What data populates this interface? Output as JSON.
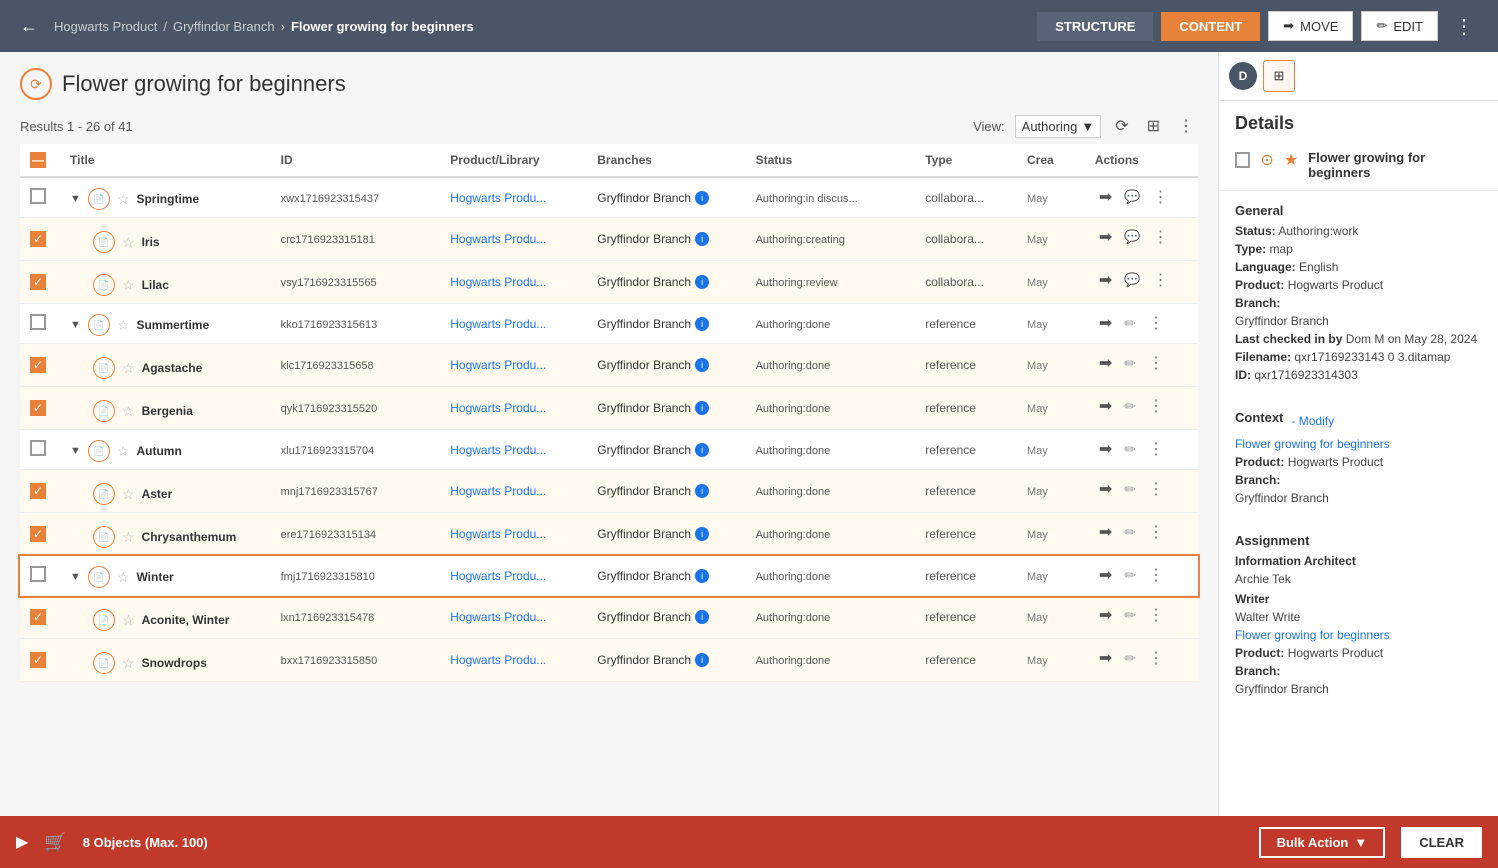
{
  "topbar": {
    "back_label": "←",
    "breadcrumb": {
      "root": "Hogwarts Product",
      "sep1": "/",
      "branch": "Gryffindor Branch",
      "sep2": "›",
      "current": "Flower growing for beginners"
    },
    "structure_label": "STRUCTURE",
    "content_label": "CONTENT",
    "move_label": "MOVE",
    "edit_label": "EDIT",
    "more_icon": "⋮"
  },
  "page": {
    "title": "Flower growing for beginners",
    "results_info": "Results 1 - 26 of 41",
    "view_label": "View:",
    "view_value": "Authoring"
  },
  "table": {
    "columns": [
      "",
      "Title",
      "ID",
      "Product/Library",
      "Branches",
      "Status",
      "Type",
      "Crea",
      "Actions"
    ],
    "rows": [
      {
        "indent": false,
        "expandable": true,
        "checked": false,
        "starred": false,
        "title": "Springtime",
        "id": "xwx1716923315437",
        "product": "Hogwarts Produ...",
        "branch": "Gryffindor Branch",
        "status": "Authoring:in discus...",
        "type": "collabora...",
        "date": "May",
        "has_move": true,
        "has_comment": true,
        "has_more": true
      },
      {
        "indent": true,
        "expandable": false,
        "checked": true,
        "starred": false,
        "title": "Iris",
        "id": "crc1716923315181",
        "product": "Hogwarts Produ...",
        "branch": "Gryffindor Branch",
        "status": "Authoring:creating",
        "type": "collabora...",
        "date": "May",
        "has_move": true,
        "has_comment": true,
        "has_more": true
      },
      {
        "indent": true,
        "expandable": false,
        "checked": true,
        "starred": false,
        "title": "Lilac",
        "id": "vsy1716923315565",
        "product": "Hogwarts Produ...",
        "branch": "Gryffindor Branch",
        "status": "Authoring:review",
        "type": "collabora...",
        "date": "May",
        "has_move": true,
        "has_comment": true,
        "has_more": true
      },
      {
        "indent": false,
        "expandable": true,
        "checked": false,
        "starred": false,
        "title": "Summertime",
        "id": "kko1716923315613",
        "product": "Hogwarts Produ...",
        "branch": "Gryffindor Branch",
        "status": "Authoring:done",
        "type": "reference",
        "date": "May",
        "has_move": true,
        "has_edit": true,
        "has_more": true
      },
      {
        "indent": true,
        "expandable": false,
        "checked": true,
        "starred": false,
        "title": "Agastache",
        "id": "kic1716923315658",
        "product": "Hogwarts Produ...",
        "branch": "Gryffindor Branch",
        "status": "Authoring:done",
        "type": "reference",
        "date": "May",
        "has_move": true,
        "has_edit": true,
        "has_more": true
      },
      {
        "indent": true,
        "expandable": false,
        "checked": true,
        "starred": false,
        "title": "Bergenia",
        "id": "qyk1716923315520",
        "product": "Hogwarts Produ...",
        "branch": "Gryffindor Branch",
        "status": "Authoring:done",
        "type": "reference",
        "date": "May",
        "has_move": true,
        "has_edit": true,
        "has_more": true
      },
      {
        "indent": false,
        "expandable": true,
        "checked": false,
        "starred": false,
        "title": "Autumn",
        "id": "xlu1716923315704",
        "product": "Hogwarts Produ...",
        "branch": "Gryffindor Branch",
        "status": "Authoring:done",
        "type": "reference",
        "date": "May",
        "has_move": true,
        "has_edit": true,
        "has_more": true
      },
      {
        "indent": true,
        "expandable": false,
        "checked": true,
        "starred": false,
        "title": "Aster",
        "id": "mnj1716923315767",
        "product": "Hogwarts Produ...",
        "branch": "Gryffindor Branch",
        "status": "Authoring:done",
        "type": "reference",
        "date": "May",
        "has_move": true,
        "has_edit": true,
        "has_more": true
      },
      {
        "indent": true,
        "expandable": false,
        "checked": true,
        "starred": false,
        "title": "Chrysanthemum",
        "id": "ere1716923315134",
        "product": "Hogwarts Produ...",
        "branch": "Gryffindor Branch",
        "status": "Authoring:done",
        "type": "reference",
        "date": "May",
        "has_move": true,
        "has_edit": true,
        "has_more": true
      },
      {
        "indent": false,
        "expandable": true,
        "checked": false,
        "starred": false,
        "title": "Winter",
        "id": "fmj1716923315810",
        "product": "Hogwarts Produ...",
        "branch": "Gryffindor Branch",
        "status": "Authoring:done",
        "type": "reference",
        "date": "May",
        "has_move": true,
        "has_edit": true,
        "has_more": true,
        "highlighted": true
      },
      {
        "indent": true,
        "expandable": false,
        "checked": true,
        "starred": false,
        "title": "Aconite, Winter",
        "id": "lxn1716923315478",
        "product": "Hogwarts Produ...",
        "branch": "Gryffindor Branch",
        "status": "Authoring:done",
        "type": "reference",
        "date": "May",
        "has_move": true,
        "has_edit": true,
        "has_more": true
      },
      {
        "indent": true,
        "expandable": false,
        "checked": true,
        "starred": false,
        "title": "Snowdrops",
        "id": "bxx1716923315850",
        "product": "Hogwarts Produ...",
        "branch": "Gryffindor Branch",
        "status": "Authoring:done",
        "type": "reference",
        "date": "May",
        "has_move": true,
        "has_edit": true,
        "has_more": true
      }
    ]
  },
  "details_panel": {
    "d_avatar": "D",
    "title": "Details",
    "item_title": "Flower growing for beginners",
    "general": {
      "label": "General",
      "status_label": "Status:",
      "status_value": "Authoring:work",
      "type_label": "Type:",
      "type_value": "map",
      "language_label": "Language:",
      "language_value": "English",
      "product_label": "Product:",
      "product_value": "Hogwarts Product",
      "branch_label": "Branch:",
      "branch_value": "Gryffindor Branch",
      "checkedin_label": "Last checked in by",
      "checkedin_value": "Dom M on May 28, 2024",
      "filename_label": "Filename:",
      "filename_value": "qxr17169233143 0 3.ditamap",
      "id_label": "ID:",
      "id_value": "qxr1716923314303"
    },
    "context": {
      "label": "Context",
      "modify_label": "- Modify",
      "map_link": "Flower growing for beginners",
      "product_label": "Product:",
      "product_value": "Hogwarts Product",
      "branch_label": "Branch:",
      "branch_value": "Gryffindor Branch"
    },
    "assignment": {
      "label": "Assignment",
      "ia_label": "Information Architect",
      "ia_value": "Archie Tek",
      "writer_label": "Writer",
      "writer_value": "Walter Write",
      "writer_map_link": "Flower growing for beginners",
      "writer_product_label": "Product:",
      "writer_product_value": "Hogwarts Product",
      "writer_branch_label": "Branch:",
      "writer_branch_value": "Gryffindor Branch"
    }
  },
  "bottom_bar": {
    "cart_icon": "🛒",
    "count_text": "8 Objects (Max. 100)",
    "bulk_action_label": "Bulk Action",
    "bulk_dropdown_icon": "▼",
    "clear_label": "CLEAR"
  }
}
